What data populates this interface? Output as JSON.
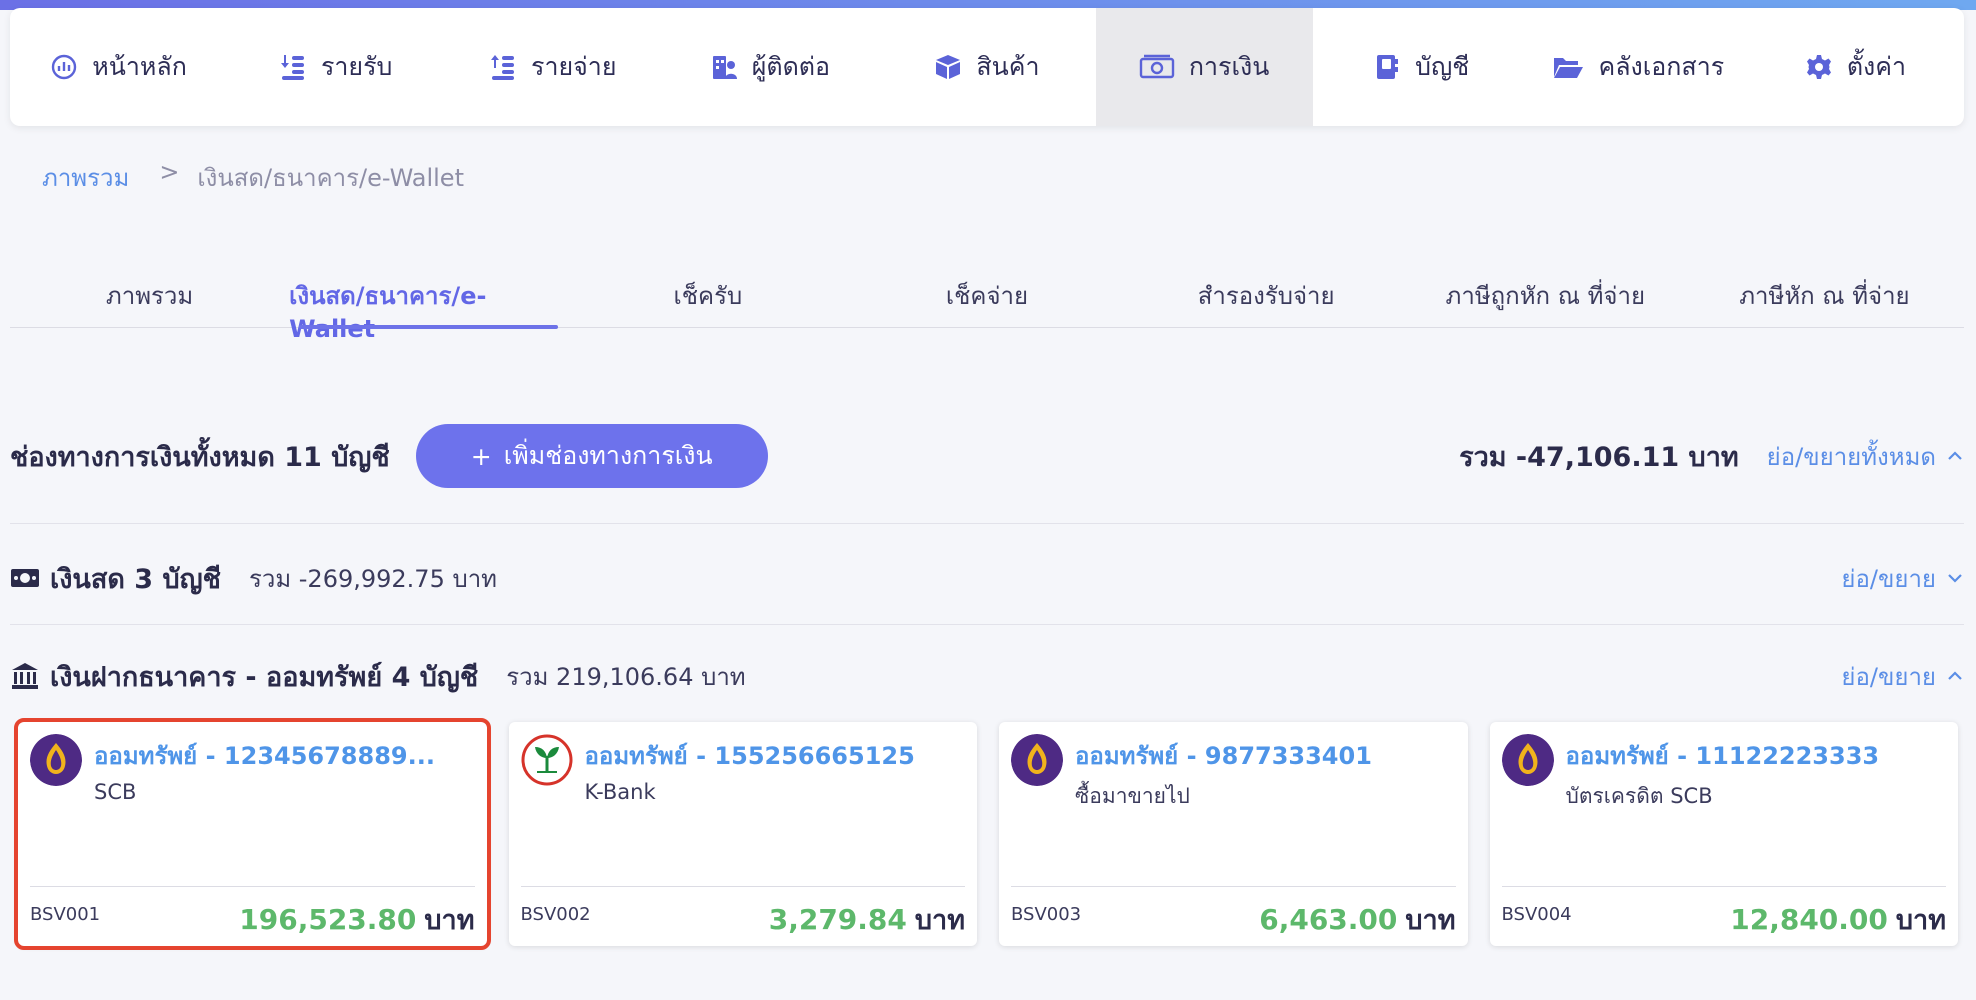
{
  "colors": {
    "accent": "#6d72ec",
    "link": "#5b8ee6",
    "amount": "#5db86b",
    "highlight": "#e5442f"
  },
  "nav": [
    {
      "label": "หน้าหลัก",
      "icon": "dashboard-icon"
    },
    {
      "label": "รายรับ",
      "icon": "income-icon"
    },
    {
      "label": "รายจ่าย",
      "icon": "expense-icon"
    },
    {
      "label": "ผู้ติดต่อ",
      "icon": "contacts-icon"
    },
    {
      "label": "สินค้า",
      "icon": "box-icon"
    },
    {
      "label": "การเงิน",
      "icon": "money-icon",
      "active": true
    },
    {
      "label": "บัญชี",
      "icon": "ledger-icon"
    },
    {
      "label": "คลังเอกสาร",
      "icon": "folder-icon"
    },
    {
      "label": "ตั้งค่า",
      "icon": "gear-icon"
    }
  ],
  "breadcrumb": {
    "root": "ภาพรวม",
    "separator": ">",
    "current": "เงินสด/ธนาคาร/e-Wallet"
  },
  "subtabs": [
    {
      "label": "ภาพรวม"
    },
    {
      "label": "เงินสด/ธนาคาร/e-Wallet",
      "active": true
    },
    {
      "label": "เช็ครับ"
    },
    {
      "label": "เช็คจ่าย"
    },
    {
      "label": "สำรองรับจ่าย"
    },
    {
      "label": "ภาษีถูกหัก ณ ที่จ่าย"
    },
    {
      "label": "ภาษีหัก ณ ที่จ่าย"
    }
  ],
  "summary": {
    "title": "ช่องทางการเงินทั้งหมด 11 บัญชี",
    "add_label": "เพิ่มช่องทางการเงิน",
    "add_icon": "+",
    "total": "รวม -47,106.11 บาท",
    "toggle_all": "ย่อ/ขยายทั้งหมด"
  },
  "cash_section": {
    "title": "เงินสด 3 บัญชี",
    "sum": "รวม -269,992.75 บาท",
    "toggle": "ย่อ/ขยาย"
  },
  "bank_section": {
    "title": "เงินฝากธนาคาร - ออมทรัพย์ 4 บัญชี",
    "sum": "รวม 219,106.64 บาท",
    "toggle": "ย่อ/ขยาย"
  },
  "accounts": [
    {
      "title": "ออมทรัพย์ - 12345678889...",
      "sub": "SCB",
      "code": "BSV001",
      "amount": "196,523.80",
      "unit": "บาท",
      "bank": "scb"
    },
    {
      "title": "ออมทรัพย์ - 155256665125",
      "sub": "K-Bank",
      "code": "BSV002",
      "amount": "3,279.84",
      "unit": "บาท",
      "bank": "kbank"
    },
    {
      "title": "ออมทรัพย์ - 9877333401",
      "sub": "ซื้อมาขายไป",
      "code": "BSV003",
      "amount": "6,463.00",
      "unit": "บาท",
      "bank": "scb"
    },
    {
      "title": "ออมทรัพย์ - 11122223333",
      "sub": "บัตรเครดิต SCB",
      "code": "BSV004",
      "amount": "12,840.00",
      "unit": "บาท",
      "bank": "scb"
    }
  ]
}
